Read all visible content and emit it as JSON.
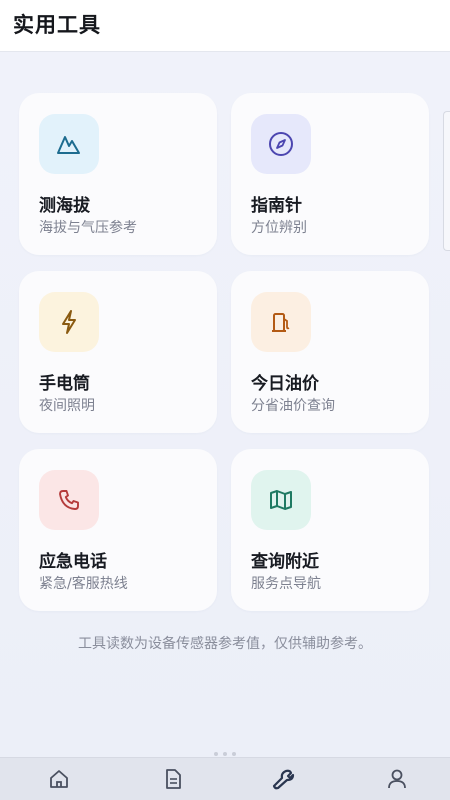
{
  "header": {
    "title": "实用工具"
  },
  "tools": [
    {
      "name": "测海拔",
      "desc": "海拔与气压参考",
      "icon": "mountain-icon",
      "icon_color": "#1d6c8f",
      "bg_color": "#e2f2fb"
    },
    {
      "name": "指南针",
      "desc": "方位辨别",
      "icon": "compass-icon",
      "icon_color": "#4c46b0",
      "bg_color": "#e6e8fb"
    },
    {
      "name": "手电筒",
      "desc": "夜间照明",
      "icon": "lightning-icon",
      "icon_color": "#8a5a10",
      "bg_color": "#fcf3de"
    },
    {
      "name": "今日油价",
      "desc": "分省油价查询",
      "icon": "fuel-pump-icon",
      "icon_color": "#b35a14",
      "bg_color": "#fcefe2"
    },
    {
      "name": "应急电话",
      "desc": "紧急/客服热线",
      "icon": "phone-icon",
      "icon_color": "#b43c3c",
      "bg_color": "#fbe6e6"
    },
    {
      "name": "查询附近",
      "desc": "服务点导航",
      "icon": "map-icon",
      "icon_color": "#1f7a62",
      "bg_color": "#e0f4ee"
    }
  ],
  "note": "工具读数为设备传感器参考值，仅供辅助参考。",
  "tabbar": {
    "items": [
      {
        "icon": "home-icon",
        "active": false
      },
      {
        "icon": "document-icon",
        "active": false
      },
      {
        "icon": "wrench-icon",
        "active": true
      },
      {
        "icon": "user-icon",
        "active": false
      }
    ],
    "active_color": "#2a3650",
    "inactive_color": "#4a5060"
  }
}
